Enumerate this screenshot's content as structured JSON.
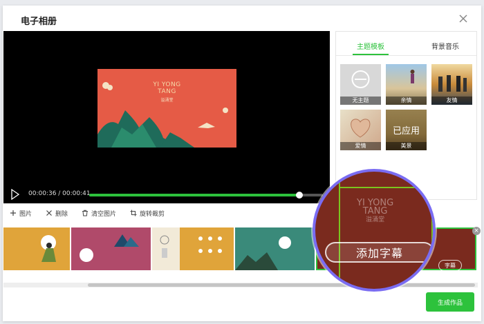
{
  "dialog": {
    "title": "电子相册"
  },
  "player": {
    "preview_title_line1": "YI YONG",
    "preview_title_line2": "TANG",
    "preview_subtitle": "溢涌堂",
    "time": "00:00:36 / 00:00:41",
    "progress": 0.9
  },
  "right_panel": {
    "tabs": [
      {
        "label": "主题模板",
        "active": true
      },
      {
        "label": "背景音乐",
        "active": false
      }
    ],
    "templates": [
      {
        "label": "无主题",
        "icon": "no-theme-icon"
      },
      {
        "label": "亲情"
      },
      {
        "label": "友情"
      },
      {
        "label": "爱情"
      },
      {
        "label": "美景",
        "status": "已应用"
      }
    ]
  },
  "toolbar": {
    "add_image": "图片",
    "delete": "删除",
    "clear_images": "清空图片",
    "rotate_crop": "旋转裁剪"
  },
  "magnifier": {
    "add_subtitle": "添加字幕",
    "bg_text_line1": "YI YONG",
    "bg_text_line2": "TANG",
    "bg_text_line3": "溢涌堂"
  },
  "strip": {
    "small_subtitle_label": "字幕",
    "remove_icon": "×"
  },
  "actions": {
    "generate": "生成作品"
  },
  "colors": {
    "accent": "#2dc23c",
    "magnifier_ring": "#7a6cf2"
  }
}
